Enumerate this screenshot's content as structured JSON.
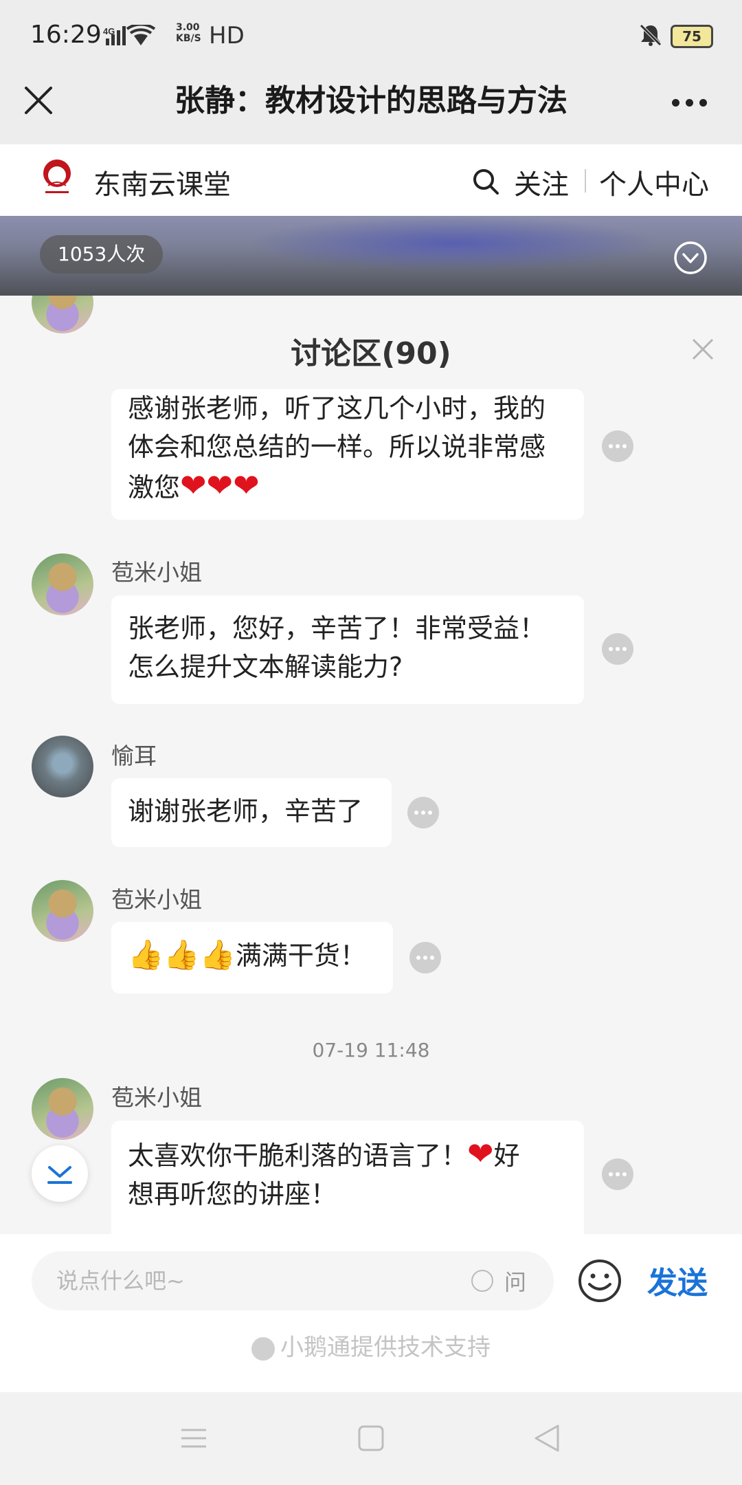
{
  "status_bar": {
    "time": "16:29",
    "network": "4G",
    "speed_value": "3.00",
    "speed_unit": "KB/S",
    "hd": "HD",
    "battery": "75"
  },
  "title_bar": {
    "title": "张静：教材设计的思路与方法"
  },
  "site_header": {
    "name": "东南云课堂",
    "follow": "关注",
    "user_center": "个人中心"
  },
  "video": {
    "view_count": "1053人次"
  },
  "discussion": {
    "title": "讨论区(90)",
    "timestamp": "07-19 11:48",
    "messages": [
      {
        "user": "",
        "line1": "感谢张老师，听了这几个小时，我的",
        "line2": "体会和您总结的一样。所以说非常感",
        "line3": "激您",
        "emoji": "❤❤❤"
      },
      {
        "user": "苞米小姐",
        "line1": "张老师，您好，辛苦了！非常受益！",
        "line2": "怎么提升文本解读能力?"
      },
      {
        "user": "愉耳",
        "line1": "谢谢张老师，辛苦了"
      },
      {
        "user": "苞米小姐",
        "emoji": "👍👍👍",
        "line1": "满满干货！"
      },
      {
        "user": "苞米小姐",
        "line1a": "太喜欢你干脆利落的语言了！",
        "emoji": "❤",
        "line1b": "好",
        "line2": "想再听您的讲座！"
      }
    ]
  },
  "input": {
    "placeholder": "说点什么吧~",
    "ask_label": "问",
    "send": "发送",
    "support": "小鹅通提供技术支持"
  },
  "colors": {
    "accent": "#1a73d8",
    "heart": "#e0121e",
    "panel_bg": "#f5f5f5"
  }
}
